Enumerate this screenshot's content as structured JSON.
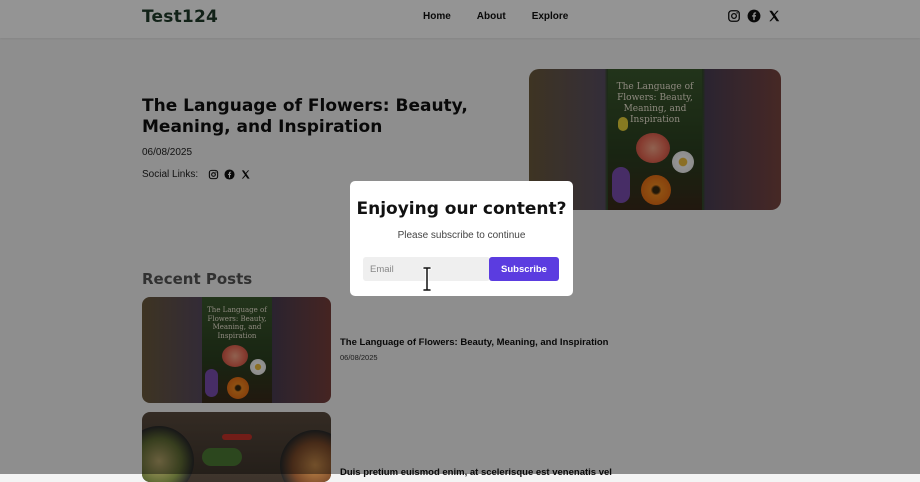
{
  "header": {
    "logo": "Test124",
    "nav": [
      {
        "label": "Home"
      },
      {
        "label": "About"
      },
      {
        "label": "Explore"
      }
    ],
    "social_icons": [
      "instagram-icon",
      "facebook-icon",
      "x-icon"
    ]
  },
  "hero": {
    "title": "The Language of Flowers: Beauty, Meaning, and Inspiration",
    "date": "06/08/2025",
    "social_label": "Social Links:",
    "image_text": "The Language of Flowers: Beauty, Meaning, and Inspiration"
  },
  "recent": {
    "title": "Recent Posts",
    "posts": [
      {
        "title": "The Language of Flowers: Beauty, Meaning, and Inspiration",
        "date": "06/08/2025",
        "image_text": "The Language of Flowers: Beauty, Meaning, and Inspiration"
      },
      {
        "title": "Duis pretium euismod enim, at scelerisque est venenatis vel"
      }
    ]
  },
  "modal": {
    "title": "Enjoying our content?",
    "subtitle": "Please subscribe to continue",
    "email_placeholder": "Email",
    "email_value": "",
    "button_label": "Subscribe"
  },
  "colors": {
    "accent": "#5b3ce0",
    "logo": "#1f3b2a",
    "overlay": "rgba(0,0,0,0.42)"
  }
}
